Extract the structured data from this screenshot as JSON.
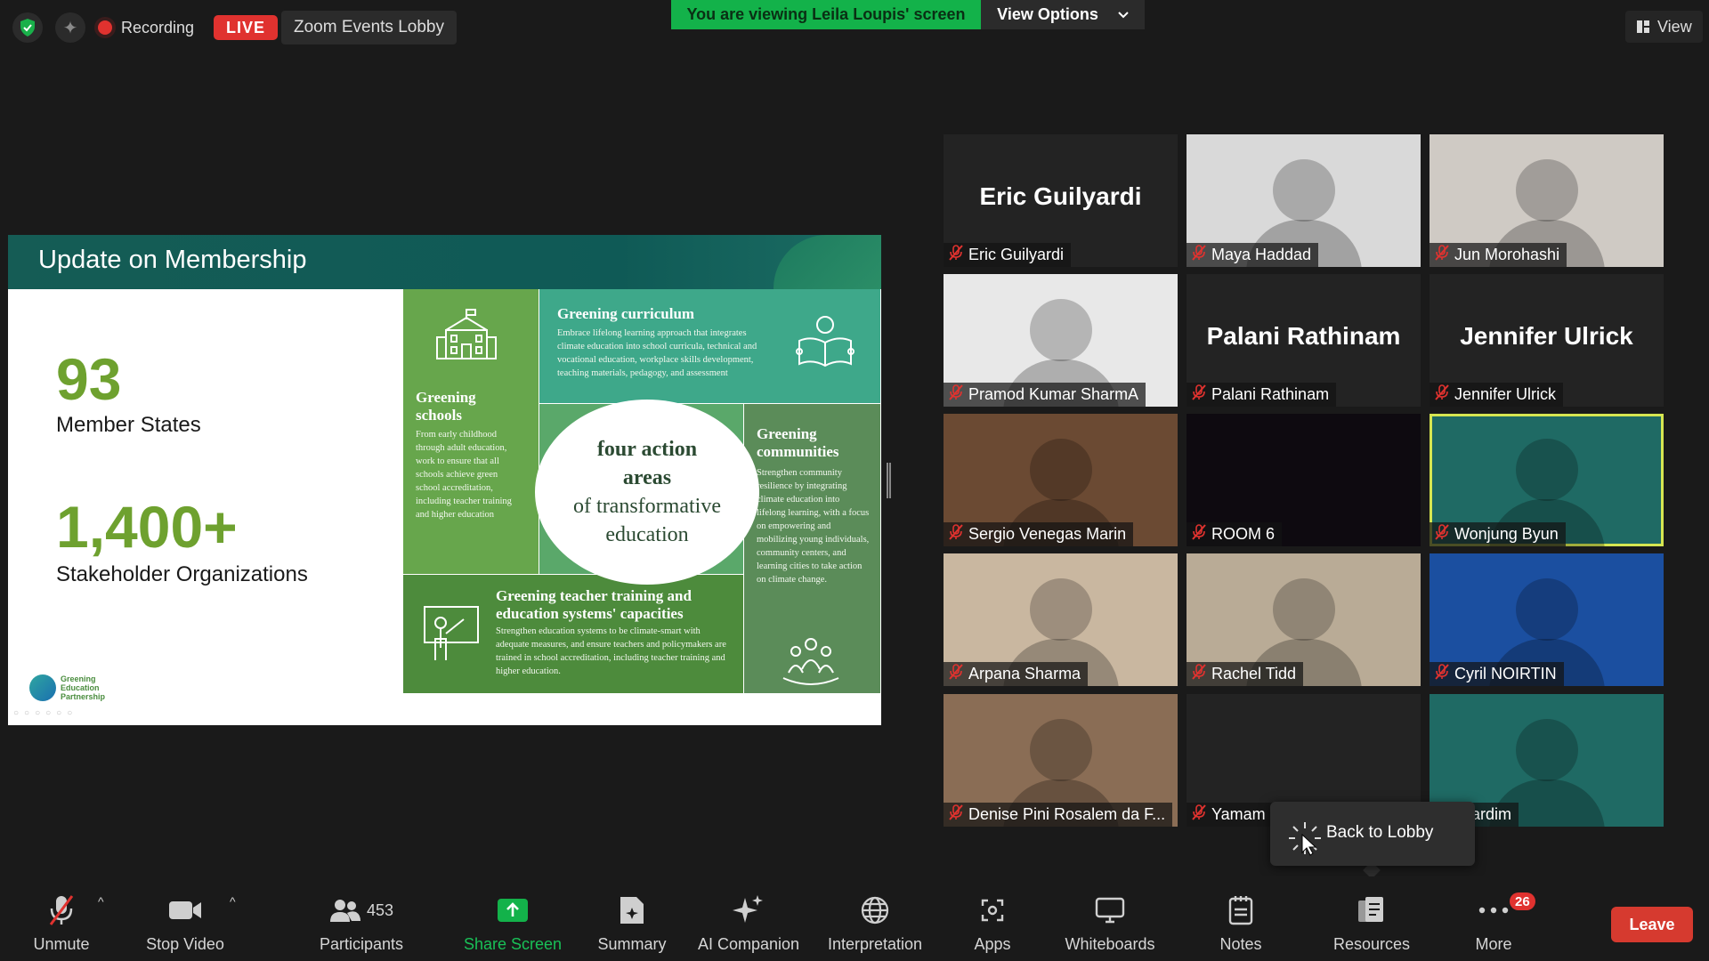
{
  "topbar": {
    "recording_label": "Recording",
    "live_label": "LIVE",
    "lobby_button": "Zoom Events Lobby",
    "viewing_banner": "You are viewing Leila Loupis' screen",
    "view_options": "View Options",
    "view_button": "View"
  },
  "slide": {
    "title": "Update on Membership",
    "stat1_value": "93",
    "stat1_label": "Member States",
    "stat2_value": "1,400+",
    "stat2_label": "Stakeholder Organizations",
    "logo_text": "Greening Education Partnership",
    "center_line1": "four action",
    "center_line2": "areas",
    "center_line3": "of transformative",
    "center_line4": "education",
    "schools_title": "Greening schools",
    "schools_text": "From early childhood through adult education, work to ensure that all schools achieve green school accreditation, including teacher training and higher education",
    "curriculum_title": "Greening curriculum",
    "curriculum_text": "Embrace lifelong learning approach that integrates climate education into school curricula, technical and vocational education, workplace skills development, teaching materials, pedagogy, and assessment",
    "communities_title": "Greening communities",
    "communities_text": "Strengthen community resilience by integrating climate education into lifelong learning, with a focus on empowering and mobilizing young individuals, community centers, and learning cities to take action on climate change.",
    "teacher_title": "Greening teacher training and education systems' capacities",
    "teacher_text": "Strengthen education systems to be climate-smart with adequate measures, and ensure teachers and policymakers are trained in school accreditation, including teacher training and higher education."
  },
  "participants": [
    {
      "name": "Eric Guilyardi",
      "big": "Eric Guilyardi",
      "bg": "#232323"
    },
    {
      "name": "Maya Haddad",
      "big": "",
      "bg": "#d9d9d9"
    },
    {
      "name": "Jun Morohashi",
      "big": "",
      "bg": "#cfcac4"
    },
    {
      "name": "Pramod Kumar SharmA",
      "big": "",
      "bg": "#e8e8e8"
    },
    {
      "name": "Palani Rathinam",
      "big": "Palani Rathinam",
      "bg": "#232323"
    },
    {
      "name": "Jennifer Ulrick",
      "big": "Jennifer Ulrick",
      "bg": "#232323"
    },
    {
      "name": "Sergio Venegas Marin",
      "big": "",
      "bg": "#6b4a33"
    },
    {
      "name": "ROOM 6",
      "big": "",
      "bg": "#0e0a10"
    },
    {
      "name": "Wonjung Byun",
      "big": "",
      "bg": "#1f6a64"
    },
    {
      "name": "Arpana Sharma",
      "big": "",
      "bg": "#c9b7a0"
    },
    {
      "name": "Rachel Tidd",
      "big": "",
      "bg": "#b9ab96"
    },
    {
      "name": "Cyril NOIRTIN",
      "big": "",
      "bg": "#1b4fa0"
    },
    {
      "name": "Denise Pini Rosalem da F...",
      "big": "",
      "bg": "#8a6d55"
    },
    {
      "name": "Yamam",
      "big": "",
      "bg": "#232323"
    },
    {
      "name": "/ Jardim",
      "big": "",
      "bg": "#1f6a64"
    }
  ],
  "tooltip": {
    "text": "Back to Lobby"
  },
  "toolbar": {
    "unmute": "Unmute",
    "stop_video": "Stop Video",
    "participants": "Participants",
    "participant_count": "453",
    "share_screen": "Share Screen",
    "summary": "Summary",
    "ai_companion": "AI Companion",
    "interpretation": "Interpretation",
    "apps": "Apps",
    "whiteboards": "Whiteboards",
    "notes": "Notes",
    "resources": "Resources",
    "more": "More",
    "more_badge": "26",
    "leave": "Leave"
  },
  "colors": {
    "share_green": "#13b24a",
    "live_red": "#e0322f",
    "leave_red": "#d63a2f",
    "active_border": "#d6e651"
  }
}
